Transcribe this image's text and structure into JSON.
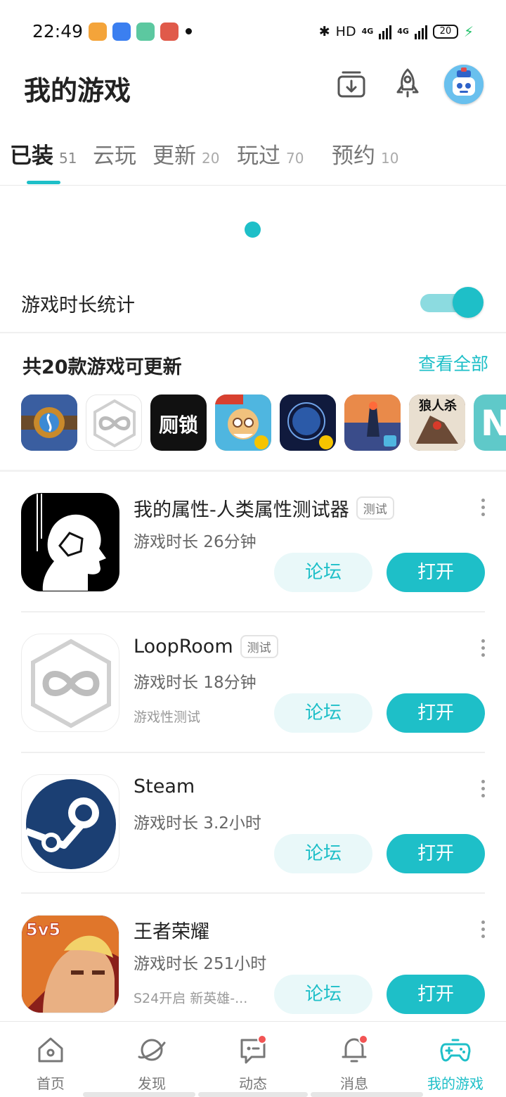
{
  "status_bar": {
    "time": "22:49",
    "hd_label": "HD",
    "net1": "4G",
    "net2": "4G",
    "battery": "20",
    "colors": {
      "charging": "#23c26b"
    }
  },
  "header": {
    "title": "我的游戏",
    "icons": [
      "download-manager-icon",
      "rocket-icon",
      "avatar"
    ]
  },
  "tabs": [
    {
      "label": "已装",
      "count": "51",
      "active": true
    },
    {
      "label": "云玩",
      "count": ""
    },
    {
      "label": "更新",
      "count": "20"
    },
    {
      "label": "玩过",
      "count": "70"
    },
    {
      "label": "预约",
      "count": "10"
    }
  ],
  "stats": {
    "label": "游戏时长统计",
    "enabled": true
  },
  "updates": {
    "title": "共20款游戏可更新",
    "view_all": "查看全部",
    "icons": [
      {
        "name": "hearthstone-icon",
        "color": "#3a5ea0"
      },
      {
        "name": "looproom-icon",
        "color": "#ffffff"
      },
      {
        "name": "cesuo-icon",
        "color": "#111111",
        "text": "厕锁"
      },
      {
        "name": "game-icon-4",
        "color": "#e8a12c"
      },
      {
        "name": "game-icon-5",
        "color": "#1c2a5e"
      },
      {
        "name": "dead-cells-icon",
        "color": "#d9533a"
      },
      {
        "name": "werewolf-icon",
        "color": "#5a3a2a",
        "text": "狼人杀"
      },
      {
        "name": "n-game-icon",
        "color": "#5fc9c9",
        "text": "N"
      }
    ]
  },
  "games": [
    {
      "name": "我的属性-人类属性测试器",
      "badge": "测试",
      "time": "游戏时长 26分钟",
      "note": "",
      "forum": "论坛",
      "open": "打开"
    },
    {
      "name": "LoopRoom",
      "badge": "测试",
      "time": "游戏时长 18分钟",
      "note": "游戏性测试",
      "forum": "论坛",
      "open": "打开"
    },
    {
      "name": "Steam",
      "badge": "",
      "time": "游戏时长 3.2小时",
      "note": "",
      "forum": "论坛",
      "open": "打开"
    },
    {
      "name": "王者荣耀",
      "badge": "",
      "time": "游戏时长 251小时",
      "note": "S24开启 新英雄-...",
      "forum": "论坛",
      "open": "打开"
    }
  ],
  "nav": [
    {
      "label": "首页",
      "icon": "home-icon"
    },
    {
      "label": "发现",
      "icon": "planet-icon"
    },
    {
      "label": "动态",
      "icon": "chat-icon",
      "dot": true
    },
    {
      "label": "消息",
      "icon": "bell-icon",
      "dot": true
    },
    {
      "label": "我的游戏",
      "icon": "gamepad-icon",
      "active": true
    }
  ],
  "colors": {
    "accent": "#1ebfc8",
    "accent_light": "#e9f8f9",
    "notification": "#f25454"
  }
}
